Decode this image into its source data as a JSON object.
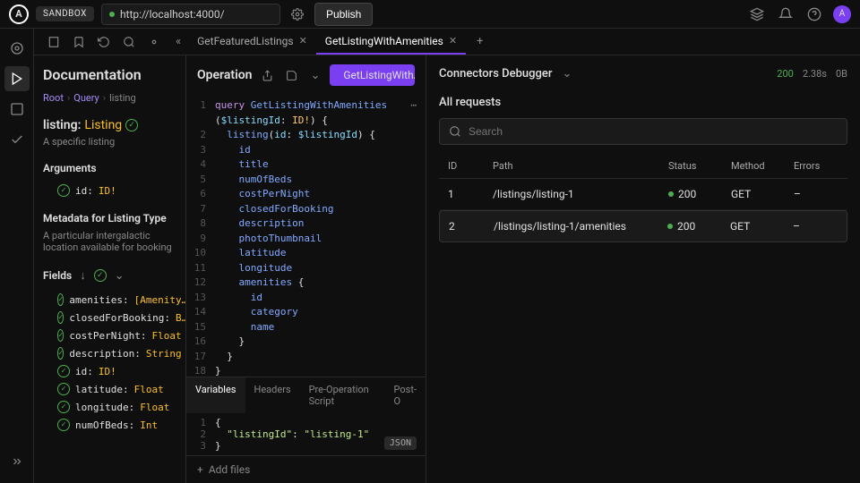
{
  "topbar": {
    "logo": "A",
    "sandbox": "SANDBOX",
    "url": "http://localhost:4000/",
    "publish": "Publish",
    "avatar": "A"
  },
  "tabs": {
    "items": [
      {
        "label": "GetFeaturedListings",
        "active": false
      },
      {
        "label": "GetListingWithAmenities",
        "active": true
      }
    ]
  },
  "doc": {
    "title": "Documentation",
    "crumbs": [
      "Root",
      "Query",
      "listing"
    ],
    "field_name": "listing:",
    "field_type": "Listing",
    "field_desc": "A specific listing",
    "args_title": "Arguments",
    "args": [
      {
        "name": "id:",
        "type": "ID!"
      }
    ],
    "metadata_title": "Metadata for Listing Type",
    "metadata_desc": "A particular intergalactic location available for booking",
    "fields_title": "Fields",
    "fields": [
      {
        "name": "amenities:",
        "type": "[Amenity…"
      },
      {
        "name": "closedForBooking:",
        "type": "B…"
      },
      {
        "name": "costPerNight:",
        "type": "Float"
      },
      {
        "name": "description:",
        "type": "String"
      },
      {
        "name": "id:",
        "type": "ID!"
      },
      {
        "name": "latitude:",
        "type": "Float"
      },
      {
        "name": "longitude:",
        "type": "Float"
      },
      {
        "name": "numOfBeds:",
        "type": "Int"
      }
    ]
  },
  "operation": {
    "title": "Operation",
    "run_label": "GetListingWithAme",
    "lines": [
      {
        "n": "1",
        "html": "<span class='kw'>query</span> <span class='fn'>GetListingWithAmenities</span>"
      },
      {
        "n": "2",
        "html": "(<span class='var'>$listingId</span>: <span class='type'>ID!</span>) {"
      },
      {
        "n": "3",
        "html": "  <span class='field'>listing</span>(<span class='var'>id</span>: <span class='var'>$listingId</span>) {"
      },
      {
        "n": "",
        "sub": [
          "id",
          "title",
          "numOfBeds",
          "costPerNight",
          "closedForBooking",
          "description",
          "photoThumbnail",
          "latitude",
          "longitude"
        ]
      },
      {
        "n": "12",
        "html": "    <span class='field'>amenities</span> {"
      },
      {
        "n": "",
        "sub2": [
          "id",
          "category",
          "name"
        ]
      },
      {
        "n": "16",
        "html": "    }"
      },
      {
        "n": "17",
        "html": "  }"
      },
      {
        "n": "18",
        "html": "}"
      }
    ],
    "simple_fields": [
      "id",
      "title",
      "numOfBeds",
      "costPerNight",
      "closedForBooking",
      "description",
      "photoThumbnail",
      "latitude",
      "longitude"
    ],
    "amenity_fields": [
      "id",
      "category",
      "name"
    ]
  },
  "bottom_tabs": [
    "Variables",
    "Headers",
    "Pre-Operation Script",
    "Post-O"
  ],
  "vars_json_badge": "JSON",
  "vars_lines": [
    {
      "n": "1",
      "html": "{"
    },
    {
      "n": "2",
      "html": "  <span class='str'>\"listingId\"</span>: <span class='str'>\"listing-1\"</span>"
    },
    {
      "n": "3",
      "html": "}"
    }
  ],
  "add_files": "Add files",
  "debugger": {
    "title": "Connectors Debugger",
    "stats": {
      "status": "200",
      "time": "2.38s",
      "size": "0B"
    },
    "all_requests": "All requests",
    "search_placeholder": "Search",
    "columns": [
      "ID",
      "Path",
      "Status",
      "Method",
      "Errors"
    ],
    "rows": [
      {
        "id": "1",
        "path": "/listings/listing-1",
        "status": "200",
        "method": "GET",
        "errors": "–"
      },
      {
        "id": "2",
        "path": "/listings/listing-1/amenities",
        "status": "200",
        "method": "GET",
        "errors": "–"
      }
    ]
  }
}
